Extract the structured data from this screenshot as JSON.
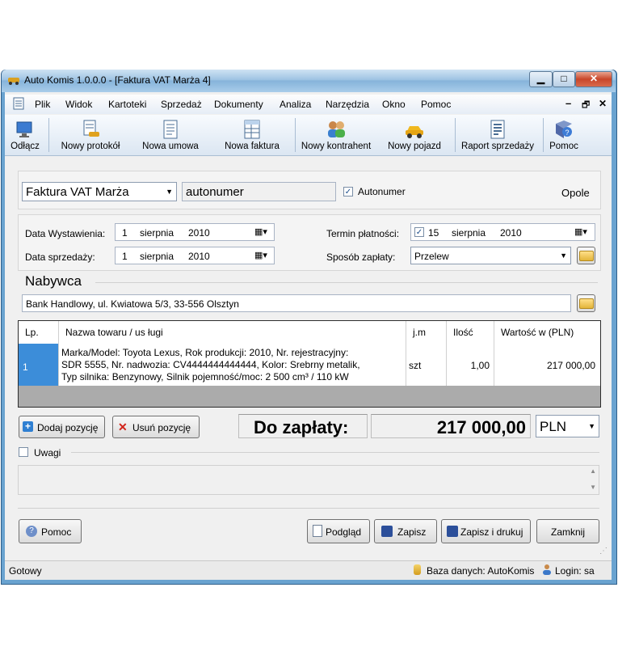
{
  "window": {
    "title": "Auto Komis 1.0.0.0 - [Faktura VAT Marża 4]",
    "minimize": "▁",
    "maximize": "□",
    "close": "✕",
    "mdi_minimize": "–",
    "mdi_restore": "🗗",
    "mdi_close": "✕"
  },
  "menu": [
    "Plik",
    "Widok",
    "Kartoteki",
    "Sprzedaż",
    "Dokumenty",
    "Analiza",
    "Narzędzia",
    "Okno",
    "Pomoc"
  ],
  "toolbar": {
    "disconnect": "Odłącz",
    "new_protocol": "Nowy protokół",
    "new_contract": "Nowa umowa",
    "new_invoice": "Nowa faktura",
    "new_contractor": "Nowy kontrahent",
    "new_vehicle": "Nowy pojazd",
    "sales_report": "Raport sprzedaży",
    "help": "Pomoc"
  },
  "document": {
    "type": "Faktura VAT Marża",
    "number": "autonumer",
    "autonumber_label": "Autonumer",
    "autonumber_checked": true,
    "city": "Opole"
  },
  "dates": {
    "issue_label": "Data Wystawienia:",
    "issue_day": "1",
    "issue_month": "sierpnia",
    "issue_year": "2010",
    "sale_label": "Data sprzedaży:",
    "sale_day": "1",
    "sale_month": "sierpnia",
    "sale_year": "2010",
    "due_label": "Termin płatności:",
    "due_checked": true,
    "due_day": "15",
    "due_month": "sierpnia",
    "due_year": "2010",
    "payment_label": "Sposób zapłaty:",
    "payment_value": "Przelew"
  },
  "buyer": {
    "heading": "Nabywca",
    "value": "Bank Handlowy, ul. Kwiatowa 5/3, 33-556 Olsztyn"
  },
  "table": {
    "headers": [
      "Lp.",
      "Nazwa towaru / us ługi",
      "j.m",
      "Ilość",
      "Wartość w (PLN)"
    ],
    "rows": [
      {
        "lp": "1",
        "name_line1": "Marka/Model: Toyota Lexus, Rok produkcji: 2010, Nr. rejestracyjny:",
        "name_line2": "SDR 5555, Nr. nadwozia: CV4444444444444, Kolor: Srebrny metalik,",
        "name_line3": "Typ silnika: Benzynowy, Silnik pojemność/moc: 2 500 cm³ / 110 kW",
        "unit": "szt",
        "qty": "1,00",
        "value": "217 000,00"
      }
    ]
  },
  "actions": {
    "add_position": "Dodaj pozycję",
    "remove_position": "Usuń pozycję",
    "to_pay_label": "Do zapłaty:",
    "to_pay_value": "217 000,00",
    "currency": "PLN"
  },
  "notes": {
    "label": "Uwagi",
    "checked": false
  },
  "bottom": {
    "help": "Pomoc",
    "preview": "Podgląd",
    "save": "Zapisz",
    "save_print": "Zapisz i drukuj",
    "close": "Zamknij"
  },
  "status": {
    "ready": "Gotowy",
    "database": "Baza danych: AutoKomis",
    "login": "Login: sa"
  },
  "colors": {
    "accent": "#3c8dd9",
    "window_frame": "#6aa3d0"
  }
}
